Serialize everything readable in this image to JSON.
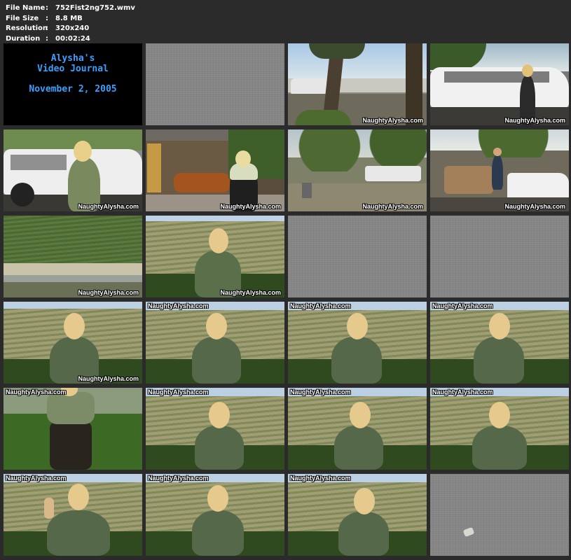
{
  "meta": {
    "rows": [
      {
        "label": "File Name",
        "sep": ":",
        "value": "752Fist2ng752.wmv"
      },
      {
        "label": "File Size",
        "sep": ":",
        "value": "8.8 MB"
      },
      {
        "label": "Resolution",
        "sep": ":",
        "value": "320x240"
      },
      {
        "label": "Duration",
        "sep": ":",
        "value": "00:02:24"
      }
    ]
  },
  "title_card": {
    "line1": "Alysha's",
    "line2": "Video Journal",
    "line3": "November 2, 2005"
  },
  "watermark": "NaughtyAlysha.com",
  "colors": {
    "title_text": "#3aa0ff",
    "background": "#2b2b2b"
  }
}
